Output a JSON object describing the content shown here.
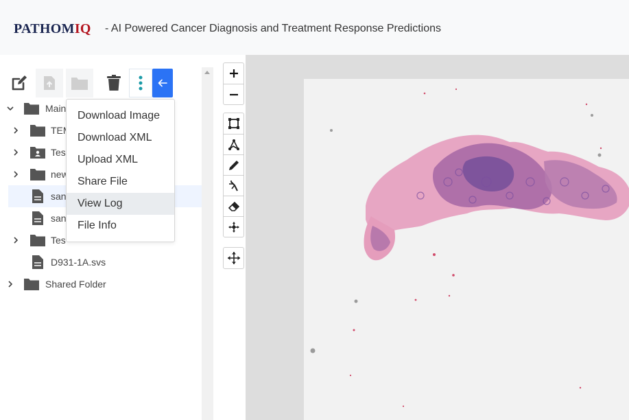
{
  "header": {
    "brand_part1": "PATHOM",
    "brand_part2": "IQ",
    "tagline": "- AI Powered Cancer Diagnosis and Treatment Response Predictions",
    "brand_colors": {
      "primary": "#1a2550",
      "accent": "#b3141e"
    }
  },
  "toolbar": {
    "buttons": [
      {
        "icon": "edit-icon",
        "enabled": true
      },
      {
        "icon": "upload-file-icon",
        "enabled": false
      },
      {
        "icon": "folder-icon",
        "enabled": false
      },
      {
        "icon": "trash-icon",
        "enabled": true
      },
      {
        "icon": "more-vertical-icon",
        "enabled": true
      },
      {
        "icon": "arrow-left-icon",
        "enabled": true
      }
    ],
    "accent_color": "#2b73f5"
  },
  "tree": {
    "rows": [
      {
        "label": "Main",
        "type": "folder",
        "expanded": true
      },
      {
        "label": "TEM",
        "type": "folder",
        "expanded": false
      },
      {
        "label": "Tes",
        "type": "shared-folder",
        "expanded": false
      },
      {
        "label": "new",
        "type": "folder",
        "expanded": false
      },
      {
        "label": "san",
        "type": "file",
        "selected": true
      },
      {
        "label": "san",
        "type": "file"
      },
      {
        "label": "Tes",
        "type": "folder",
        "expanded": false
      },
      {
        "label": "D931-1A.svs",
        "type": "file"
      },
      {
        "label": "Shared Folder",
        "type": "folder",
        "expanded": false
      }
    ]
  },
  "context_menu": {
    "items": [
      {
        "label": "Download Image"
      },
      {
        "label": "Download XML"
      },
      {
        "label": "Upload XML"
      },
      {
        "label": "Share File"
      },
      {
        "label": "View Log",
        "hovered": true
      },
      {
        "label": "File Info"
      }
    ]
  },
  "viewer_tools": {
    "zoom": [
      {
        "icon": "zoom-in-icon",
        "glyph": "+"
      },
      {
        "icon": "zoom-out-icon",
        "glyph": "−"
      }
    ],
    "annotation": [
      {
        "icon": "rectangle-tool-icon"
      },
      {
        "icon": "polygon-tool-icon"
      },
      {
        "icon": "pencil-tool-icon"
      },
      {
        "icon": "magic-wand-icon"
      },
      {
        "icon": "eraser-icon"
      },
      {
        "icon": "move-points-icon"
      }
    ],
    "pan": [
      {
        "icon": "pan-move-icon"
      }
    ]
  },
  "viewer": {
    "background_color": "#dddddd",
    "slide_color": "#f2f2f2",
    "tissue_colors": [
      "#e9a9c6",
      "#b56fa8",
      "#6b4a9a"
    ]
  }
}
